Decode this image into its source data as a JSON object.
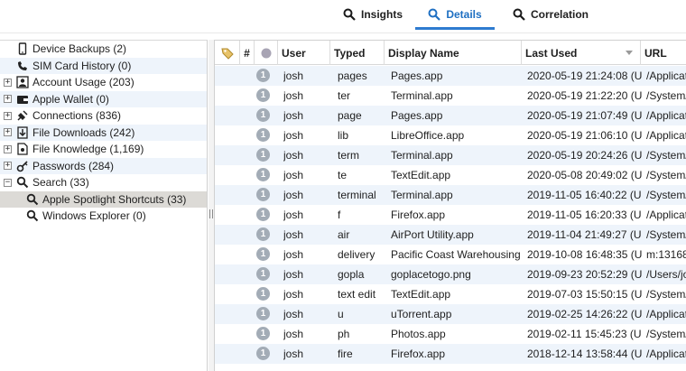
{
  "tabs": {
    "insights": "Insights",
    "details": "Details",
    "correlation": "Correlation"
  },
  "tree": {
    "items": [
      {
        "label": "Device Backups (2)",
        "icon": "phone-icon",
        "expandable": false,
        "indent": 1,
        "state": ""
      },
      {
        "label": "SIM Card History (0)",
        "icon": "telephone-icon",
        "expandable": false,
        "indent": 1,
        "state": ""
      },
      {
        "label": "Account Usage (203)",
        "icon": "user-account-icon",
        "expandable": true,
        "indent": 1,
        "state": "+"
      },
      {
        "label": "Apple Wallet (0)",
        "icon": "wallet-icon",
        "expandable": true,
        "indent": 1,
        "state": "+"
      },
      {
        "label": "Connections (836)",
        "icon": "plug-icon",
        "expandable": true,
        "indent": 1,
        "state": "+"
      },
      {
        "label": "File Downloads (242)",
        "icon": "download-icon",
        "expandable": true,
        "indent": 1,
        "state": "+"
      },
      {
        "label": "File Knowledge (1,169)",
        "icon": "file-knowledge-icon",
        "expandable": true,
        "indent": 1,
        "state": "+"
      },
      {
        "label": "Passwords (284)",
        "icon": "key-icon",
        "expandable": true,
        "indent": 1,
        "state": "+"
      },
      {
        "label": "Search (33)",
        "icon": "search-icon",
        "expandable": true,
        "indent": 1,
        "state": "−"
      },
      {
        "label": "Apple Spotlight Shortcuts (33)",
        "icon": "search-icon",
        "expandable": false,
        "indent": 2,
        "state": "",
        "selected": true
      },
      {
        "label": "Windows Explorer (0)",
        "icon": "search-icon",
        "expandable": false,
        "indent": 2,
        "state": ""
      }
    ]
  },
  "grid": {
    "headers": {
      "number": "#",
      "user": "User",
      "typed": "Typed",
      "display_name": "Display Name",
      "last_used": "Last Used",
      "url": "URL"
    },
    "rows": [
      {
        "badge": "1",
        "user": "josh",
        "typed": "pages",
        "display_name": "Pages.app",
        "last_used": "2020-05-19 21:24:08 (U",
        "url": "/Applicat"
      },
      {
        "badge": "1",
        "user": "josh",
        "typed": "ter",
        "display_name": "Terminal.app",
        "last_used": "2020-05-19 21:22:20 (U",
        "url": "/System/."
      },
      {
        "badge": "1",
        "user": "josh",
        "typed": "page",
        "display_name": "Pages.app",
        "last_used": "2020-05-19 21:07:49 (U",
        "url": "/Applicat"
      },
      {
        "badge": "1",
        "user": "josh",
        "typed": "lib",
        "display_name": "LibreOffice.app",
        "last_used": "2020-05-19 21:06:10 (U",
        "url": "/Applicat"
      },
      {
        "badge": "1",
        "user": "josh",
        "typed": "term",
        "display_name": "Terminal.app",
        "last_used": "2020-05-19 20:24:26 (U",
        "url": "/System/."
      },
      {
        "badge": "1",
        "user": "josh",
        "typed": "te",
        "display_name": "TextEdit.app",
        "last_used": "2020-05-08 20:49:02 (U",
        "url": "/System/."
      },
      {
        "badge": "1",
        "user": "josh",
        "typed": "terminal",
        "display_name": "Terminal.app",
        "last_used": "2019-11-05 16:40:22 (U",
        "url": "/System/."
      },
      {
        "badge": "1",
        "user": "josh",
        "typed": "f",
        "display_name": "Firefox.app",
        "last_used": "2019-11-05 16:20:33 (U",
        "url": "/Applicat"
      },
      {
        "badge": "1",
        "user": "josh",
        "typed": "air",
        "display_name": "AirPort Utility.app",
        "last_used": "2019-11-04 21:49:27 (U",
        "url": "/System/."
      },
      {
        "badge": "1",
        "user": "josh",
        "typed": "delivery",
        "display_name": "Pacific Coast Warehousing",
        "last_used": "2019-10-08 16:48:35 (U",
        "url": "m:131681"
      },
      {
        "badge": "1",
        "user": "josh",
        "typed": "gopla",
        "display_name": "goplacetogo.png",
        "last_used": "2019-09-23 20:52:29 (U",
        "url": "/Users/jo"
      },
      {
        "badge": "1",
        "user": "josh",
        "typed": "text edit",
        "display_name": "TextEdit.app",
        "last_used": "2019-07-03 15:50:15 (U",
        "url": "/System/."
      },
      {
        "badge": "1",
        "user": "josh",
        "typed": "u",
        "display_name": "uTorrent.app",
        "last_used": "2019-02-25 14:26:22 (U",
        "url": "/Applicat"
      },
      {
        "badge": "1",
        "user": "josh",
        "typed": "ph",
        "display_name": "Photos.app",
        "last_used": "2019-02-11 15:45:23 (U",
        "url": "/System/."
      },
      {
        "badge": "1",
        "user": "josh",
        "typed": "fire",
        "display_name": "Firefox.app",
        "last_used": "2018-12-14 13:58:44 (U",
        "url": "/Applicat"
      }
    ]
  }
}
